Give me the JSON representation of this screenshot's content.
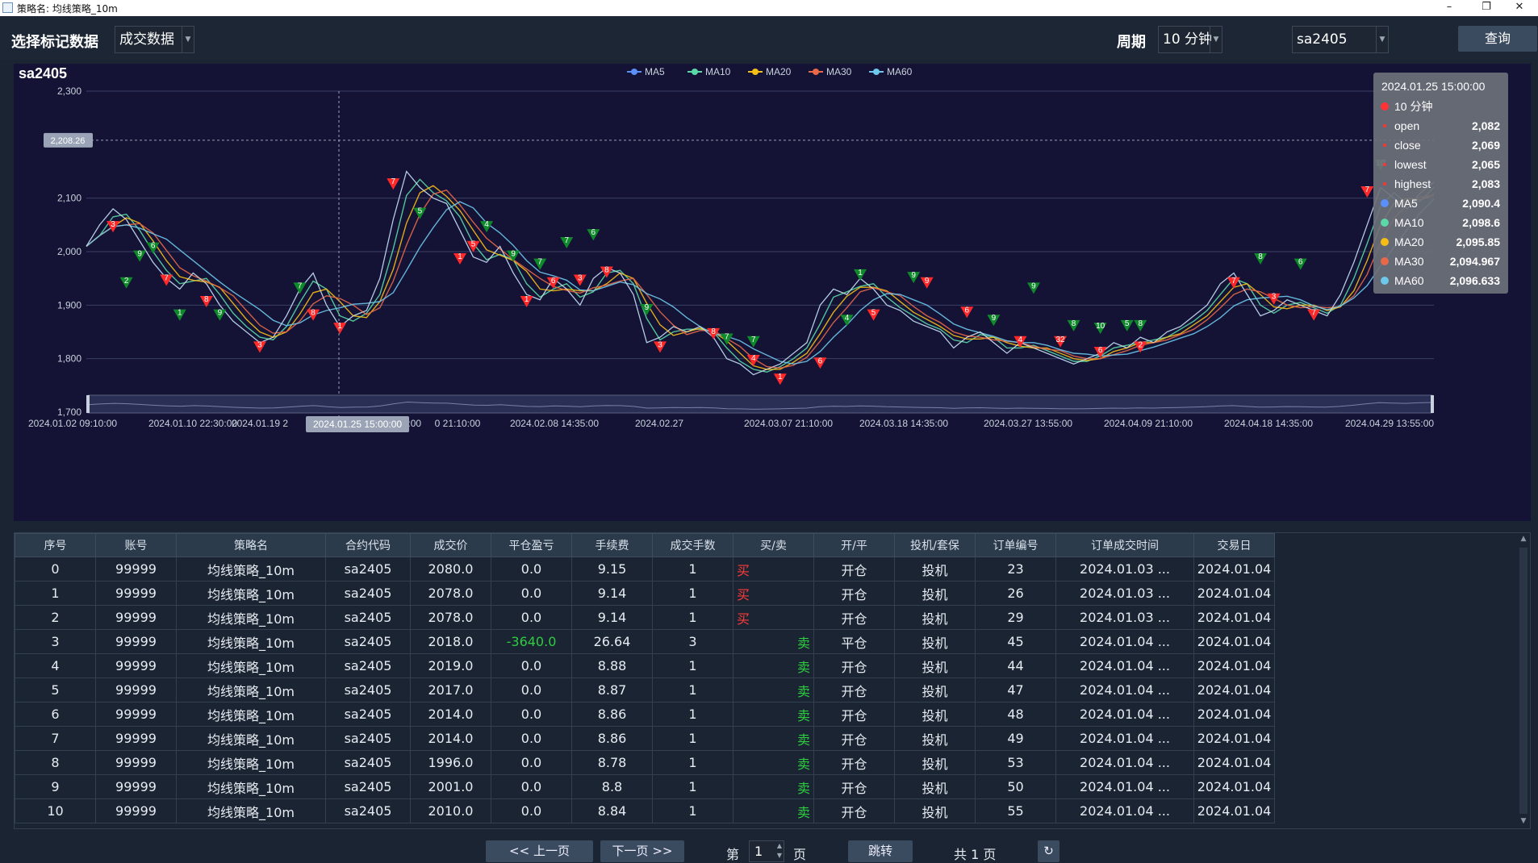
{
  "window": {
    "title": "策略名: 均线策略_10m",
    "min": "–",
    "max": "❐",
    "close": "✕"
  },
  "toolbar": {
    "mark_label": "选择标记数据",
    "mark_value": "成交数据",
    "period_label": "周期",
    "period_value": "10 分钟",
    "symbol_value": "sa2405",
    "query": "查询"
  },
  "chart_data": {
    "type": "line",
    "title": "sa2405",
    "legend": [
      "MA5",
      "MA10",
      "MA20",
      "MA30",
      "MA60"
    ],
    "legend_colors": [
      "#5b8ff9",
      "#5ad8a6",
      "#f6bd16",
      "#e8684a",
      "#6dc8ec"
    ],
    "ylim": [
      1700,
      2300
    ],
    "yticks": [
      "2,300",
      "2,100",
      "2,000",
      "1,900",
      "1,800",
      "1,700"
    ],
    "ytick_values": [
      2300,
      2100,
      2000,
      1900,
      1800,
      1700
    ],
    "xticks": [
      "2024.01.02 09:10:00",
      "2024.01.10 22:30:00",
      "2024.01.19 2",
      "2024.01.25 15:00:00",
      "0 21:10:00",
      "2024.02.08 14:35:00",
      "2024.02.27",
      "2024.03.07 21:10:00",
      "2024.03.18 14:35:00",
      "2024.03.27 13:55:00",
      "2024.04.09 21:10:00",
      "2024.04.18 14:35:00",
      "2024.04.29 13:55:00"
    ],
    "cursor_x_label": "2024.01.25 15:00:00",
    "cursor_y_label": "2,208.26",
    "cursor_y_value": 2208.26,
    "series_close": [
      2010,
      2050,
      2080,
      2060,
      2020,
      1980,
      1950,
      1930,
      1960,
      1940,
      1900,
      1870,
      1850,
      1830,
      1840,
      1880,
      1930,
      1960,
      1900,
      1860,
      1880,
      1890,
      1950,
      2060,
      2150,
      2120,
      2100,
      2090,
      2040,
      1990,
      1980,
      2010,
      1960,
      1920,
      1910,
      1950,
      1930,
      1900,
      1950,
      1970,
      1960,
      1920,
      1830,
      1840,
      1860,
      1850,
      1860,
      1840,
      1800,
      1790,
      1770,
      1780,
      1790,
      1810,
      1830,
      1900,
      1930,
      1920,
      1950,
      1930,
      1900,
      1890,
      1870,
      1860,
      1850,
      1820,
      1840,
      1850,
      1830,
      1810,
      1830,
      1820,
      1810,
      1800,
      1790,
      1800,
      1810,
      1830,
      1820,
      1840,
      1830,
      1850,
      1860,
      1880,
      1900,
      1940,
      1960,
      1920,
      1880,
      1890,
      1910,
      1900,
      1890,
      1880,
      1920,
      1980,
      2050,
      2120,
      2100,
      2080,
      2110,
      2130
    ],
    "markers": [
      {
        "i": 2,
        "v": 2045,
        "side": "buy",
        "t": "3"
      },
      {
        "i": 6,
        "v": 1945,
        "side": "buy",
        "t": "7"
      },
      {
        "i": 9,
        "v": 1905,
        "side": "buy",
        "t": "8"
      },
      {
        "i": 13,
        "v": 1820,
        "side": "buy",
        "t": "3"
      },
      {
        "i": 17,
        "v": 1880,
        "side": "buy",
        "t": "8"
      },
      {
        "i": 19,
        "v": 1855,
        "side": "buy",
        "t": "1"
      },
      {
        "i": 23,
        "v": 2125,
        "side": "buy",
        "t": "7"
      },
      {
        "i": 29,
        "v": 2008,
        "side": "buy",
        "t": "5"
      },
      {
        "i": 28,
        "v": 1985,
        "side": "buy",
        "t": "1"
      },
      {
        "i": 33,
        "v": 1905,
        "side": "buy",
        "t": "1"
      },
      {
        "i": 35,
        "v": 1940,
        "side": "buy",
        "t": "6"
      },
      {
        "i": 37,
        "v": 1945,
        "side": "buy",
        "t": "3"
      },
      {
        "i": 39,
        "v": 1960,
        "side": "buy",
        "t": "8"
      },
      {
        "i": 43,
        "v": 1820,
        "side": "buy",
        "t": "3"
      },
      {
        "i": 47,
        "v": 1845,
        "side": "buy",
        "t": "8"
      },
      {
        "i": 50,
        "v": 1795,
        "side": "buy",
        "t": "4"
      },
      {
        "i": 52,
        "v": 1760,
        "side": "buy",
        "t": "1"
      },
      {
        "i": 55,
        "v": 1790,
        "side": "buy",
        "t": "6"
      },
      {
        "i": 59,
        "v": 1880,
        "side": "buy",
        "t": "5"
      },
      {
        "i": 63,
        "v": 1940,
        "side": "buy",
        "t": "9"
      },
      {
        "i": 66,
        "v": 1885,
        "side": "buy",
        "t": "6"
      },
      {
        "i": 70,
        "v": 1830,
        "side": "buy",
        "t": "4"
      },
      {
        "i": 73,
        "v": 1830,
        "side": "buy",
        "t": "32"
      },
      {
        "i": 76,
        "v": 1810,
        "side": "buy",
        "t": "6"
      },
      {
        "i": 79,
        "v": 1820,
        "side": "buy",
        "t": "2"
      },
      {
        "i": 86,
        "v": 1940,
        "side": "buy",
        "t": "7"
      },
      {
        "i": 89,
        "v": 1910,
        "side": "buy",
        "t": "3"
      },
      {
        "i": 92,
        "v": 1880,
        "side": "buy",
        "t": "7"
      },
      {
        "i": 96,
        "v": 2110,
        "side": "buy",
        "t": "7"
      },
      {
        "i": 4,
        "v": 1990,
        "side": "sell",
        "t": "9"
      },
      {
        "i": 5,
        "v": 2005,
        "side": "sell",
        "t": "6"
      },
      {
        "i": 3,
        "v": 1940,
        "side": "sell",
        "t": "2"
      },
      {
        "i": 7,
        "v": 1880,
        "side": "sell",
        "t": "1"
      },
      {
        "i": 10,
        "v": 1880,
        "side": "sell",
        "t": "9"
      },
      {
        "i": 16,
        "v": 1930,
        "side": "sell",
        "t": "7"
      },
      {
        "i": 25,
        "v": 2070,
        "side": "sell",
        "t": "5"
      },
      {
        "i": 30,
        "v": 2045,
        "side": "sell",
        "t": "4"
      },
      {
        "i": 32,
        "v": 1990,
        "side": "sell",
        "t": "9"
      },
      {
        "i": 34,
        "v": 1975,
        "side": "sell",
        "t": "7"
      },
      {
        "i": 36,
        "v": 2015,
        "side": "sell",
        "t": "7"
      },
      {
        "i": 38,
        "v": 2030,
        "side": "sell",
        "t": "6"
      },
      {
        "i": 42,
        "v": 1890,
        "side": "sell",
        "t": "9"
      },
      {
        "i": 48,
        "v": 1835,
        "side": "sell",
        "t": "7"
      },
      {
        "i": 50,
        "v": 1830,
        "side": "sell",
        "t": "7"
      },
      {
        "i": 57,
        "v": 1870,
        "side": "sell",
        "t": "4"
      },
      {
        "i": 58,
        "v": 1955,
        "side": "sell",
        "t": "1"
      },
      {
        "i": 62,
        "v": 1950,
        "side": "sell",
        "t": "9"
      },
      {
        "i": 68,
        "v": 1870,
        "side": "sell",
        "t": "9"
      },
      {
        "i": 71,
        "v": 1930,
        "side": "sell",
        "t": "9"
      },
      {
        "i": 74,
        "v": 1860,
        "side": "sell",
        "t": "8"
      },
      {
        "i": 76,
        "v": 1855,
        "side": "sell",
        "t": "10"
      },
      {
        "i": 78,
        "v": 1860,
        "side": "sell",
        "t": "5"
      },
      {
        "i": 79,
        "v": 1860,
        "side": "sell",
        "t": "8"
      },
      {
        "i": 88,
        "v": 1985,
        "side": "sell",
        "t": "8"
      },
      {
        "i": 91,
        "v": 1975,
        "side": "sell",
        "t": "6"
      },
      {
        "i": 97,
        "v": 2160,
        "side": "sell",
        "t": "10"
      }
    ],
    "tooltip": {
      "time": "2024.01.25 15:00:00",
      "period": "10 分钟",
      "rows": [
        {
          "k": "open",
          "v": "2,082",
          "c": "#ff3333"
        },
        {
          "k": "close",
          "v": "2,069",
          "c": "#ff3333"
        },
        {
          "k": "lowest",
          "v": "2,065",
          "c": "#ff3333"
        },
        {
          "k": "highest",
          "v": "2,083",
          "c": "#ff3333"
        },
        {
          "k": "MA5",
          "v": "2,090.4",
          "c": "#5b8ff9"
        },
        {
          "k": "MA10",
          "v": "2,098.6",
          "c": "#5ad8a6"
        },
        {
          "k": "MA20",
          "v": "2,095.85",
          "c": "#f6bd16"
        },
        {
          "k": "MA30",
          "v": "2,094.967",
          "c": "#e8684a"
        },
        {
          "k": "MA60",
          "v": "2,096.633",
          "c": "#6dc8ec"
        }
      ]
    },
    "buy_color": "#ff2828",
    "sell_color": "#0f8a2a"
  },
  "table": {
    "headers": [
      "序号",
      "账号",
      "策略名",
      "合约代码",
      "成交价",
      "平仓盈亏",
      "手续费",
      "成交手数",
      "买/卖",
      "开/平",
      "投机/套保",
      "订单编号",
      "订单成交时间",
      "交易日"
    ],
    "rows": [
      [
        "0",
        "99999",
        "均线策略_10m",
        "sa2405",
        "2080.0",
        "0.0",
        "9.15",
        "1",
        "买",
        "开仓",
        "投机",
        "23",
        "2024.01.03 ...",
        "2024.01.04"
      ],
      [
        "1",
        "99999",
        "均线策略_10m",
        "sa2405",
        "2078.0",
        "0.0",
        "9.14",
        "1",
        "买",
        "开仓",
        "投机",
        "26",
        "2024.01.03 ...",
        "2024.01.04"
      ],
      [
        "2",
        "99999",
        "均线策略_10m",
        "sa2405",
        "2078.0",
        "0.0",
        "9.14",
        "1",
        "买",
        "开仓",
        "投机",
        "29",
        "2024.01.03 ...",
        "2024.01.04"
      ],
      [
        "3",
        "99999",
        "均线策略_10m",
        "sa2405",
        "2018.0",
        "-3640.0",
        "26.64",
        "3",
        "卖",
        "平仓",
        "投机",
        "45",
        "2024.01.04 ...",
        "2024.01.04"
      ],
      [
        "4",
        "99999",
        "均线策略_10m",
        "sa2405",
        "2019.0",
        "0.0",
        "8.88",
        "1",
        "卖",
        "开仓",
        "投机",
        "44",
        "2024.01.04 ...",
        "2024.01.04"
      ],
      [
        "5",
        "99999",
        "均线策略_10m",
        "sa2405",
        "2017.0",
        "0.0",
        "8.87",
        "1",
        "卖",
        "开仓",
        "投机",
        "47",
        "2024.01.04 ...",
        "2024.01.04"
      ],
      [
        "6",
        "99999",
        "均线策略_10m",
        "sa2405",
        "2014.0",
        "0.0",
        "8.86",
        "1",
        "卖",
        "开仓",
        "投机",
        "48",
        "2024.01.04 ...",
        "2024.01.04"
      ],
      [
        "7",
        "99999",
        "均线策略_10m",
        "sa2405",
        "2014.0",
        "0.0",
        "8.86",
        "1",
        "卖",
        "开仓",
        "投机",
        "49",
        "2024.01.04 ...",
        "2024.01.04"
      ],
      [
        "8",
        "99999",
        "均线策略_10m",
        "sa2405",
        "1996.0",
        "0.0",
        "8.78",
        "1",
        "卖",
        "开仓",
        "投机",
        "53",
        "2024.01.04 ...",
        "2024.01.04"
      ],
      [
        "9",
        "99999",
        "均线策略_10m",
        "sa2405",
        "2001.0",
        "0.0",
        "8.8",
        "1",
        "卖",
        "开仓",
        "投机",
        "50",
        "2024.01.04 ...",
        "2024.01.04"
      ],
      [
        "10",
        "99999",
        "均线策略_10m",
        "sa2405",
        "2010.0",
        "0.0",
        "8.84",
        "1",
        "卖",
        "开仓",
        "投机",
        "55",
        "2024.01.04 ...",
        "2024.01.04"
      ]
    ]
  },
  "pager": {
    "prev": "<< 上一页",
    "next": "下一页 >>",
    "page_prefix": "第",
    "page_value": "1",
    "page_suffix": "页",
    "jump": "跳转",
    "total": "共 1 页",
    "refresh_icon": "refresh-icon"
  }
}
